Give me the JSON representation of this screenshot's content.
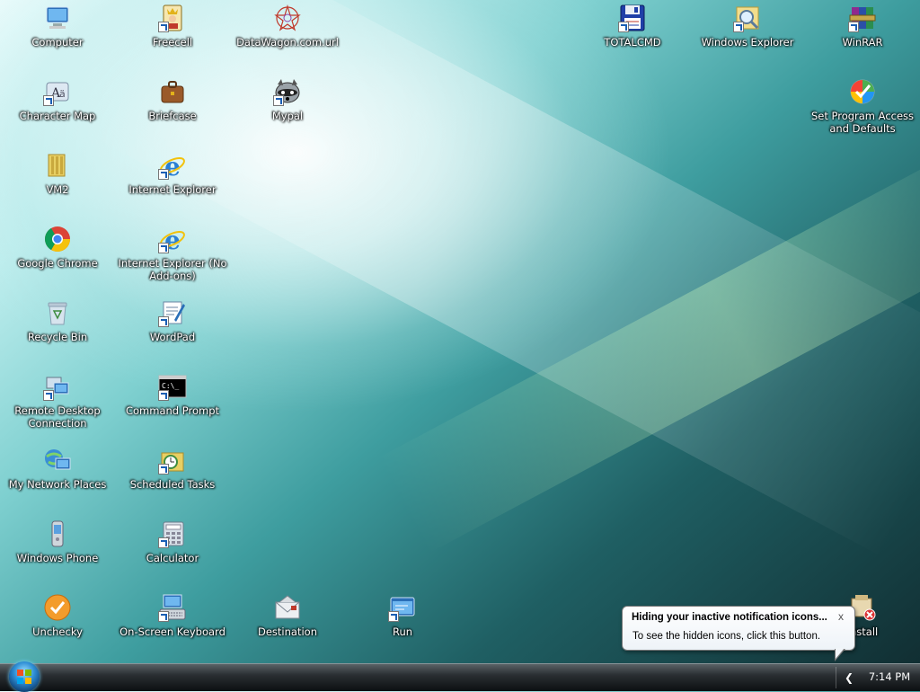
{
  "desktop": {
    "icons": [
      {
        "label": "Computer",
        "icon": "computer-icon"
      },
      {
        "label": "Freecell",
        "icon": "freecell-icon"
      },
      {
        "label": "DataWagon.com.url",
        "icon": "url-shortcut-icon"
      },
      {
        "label": "TOTALCMD",
        "icon": "floppy-disk-icon"
      },
      {
        "label": "Windows Explorer",
        "icon": "explorer-folder-icon"
      },
      {
        "label": "WinRAR",
        "icon": "winrar-icon"
      },
      {
        "label": "Character Map",
        "icon": "character-map-icon"
      },
      {
        "label": "Briefcase",
        "icon": "briefcase-icon"
      },
      {
        "label": "Mypal",
        "icon": "mypal-raccoon-icon"
      },
      {
        "label": "Set Program Access and Defaults",
        "icon": "program-defaults-icon"
      },
      {
        "label": "VM2",
        "icon": "folder-icon"
      },
      {
        "label": "Internet Explorer",
        "icon": "internet-explorer-icon"
      },
      {
        "label": "Google Chrome",
        "icon": "chrome-icon"
      },
      {
        "label": "Internet Explorer (No Add-ons)",
        "icon": "internet-explorer-icon"
      },
      {
        "label": "Recycle Bin",
        "icon": "recycle-bin-icon"
      },
      {
        "label": "WordPad",
        "icon": "wordpad-icon"
      },
      {
        "label": "Remote Desktop Connection",
        "icon": "remote-desktop-icon"
      },
      {
        "label": "Command Prompt",
        "icon": "command-prompt-icon"
      },
      {
        "label": "My Network Places",
        "icon": "network-places-icon"
      },
      {
        "label": "Scheduled Tasks",
        "icon": "scheduled-tasks-icon"
      },
      {
        "label": "Windows Phone",
        "icon": "phone-icon"
      },
      {
        "label": "Calculator",
        "icon": "calculator-icon"
      },
      {
        "label": "Unchecky",
        "icon": "unchecky-icon"
      },
      {
        "label": "On-Screen Keyboard",
        "icon": "keyboard-icon"
      },
      {
        "label": "Destination",
        "icon": "mail-envelope-icon"
      },
      {
        "label": "Run",
        "icon": "run-icon"
      },
      {
        "label": "install",
        "icon": "installer-icon"
      }
    ]
  },
  "taskbar": {
    "clock": "7:14 PM"
  },
  "balloon": {
    "title": "Hiding your inactive notification icons...",
    "body": "To see the hidden icons, click this button.",
    "close": "x"
  },
  "colors": {
    "accent": "#2f8fd6",
    "taskbar": "#1a1f22"
  }
}
